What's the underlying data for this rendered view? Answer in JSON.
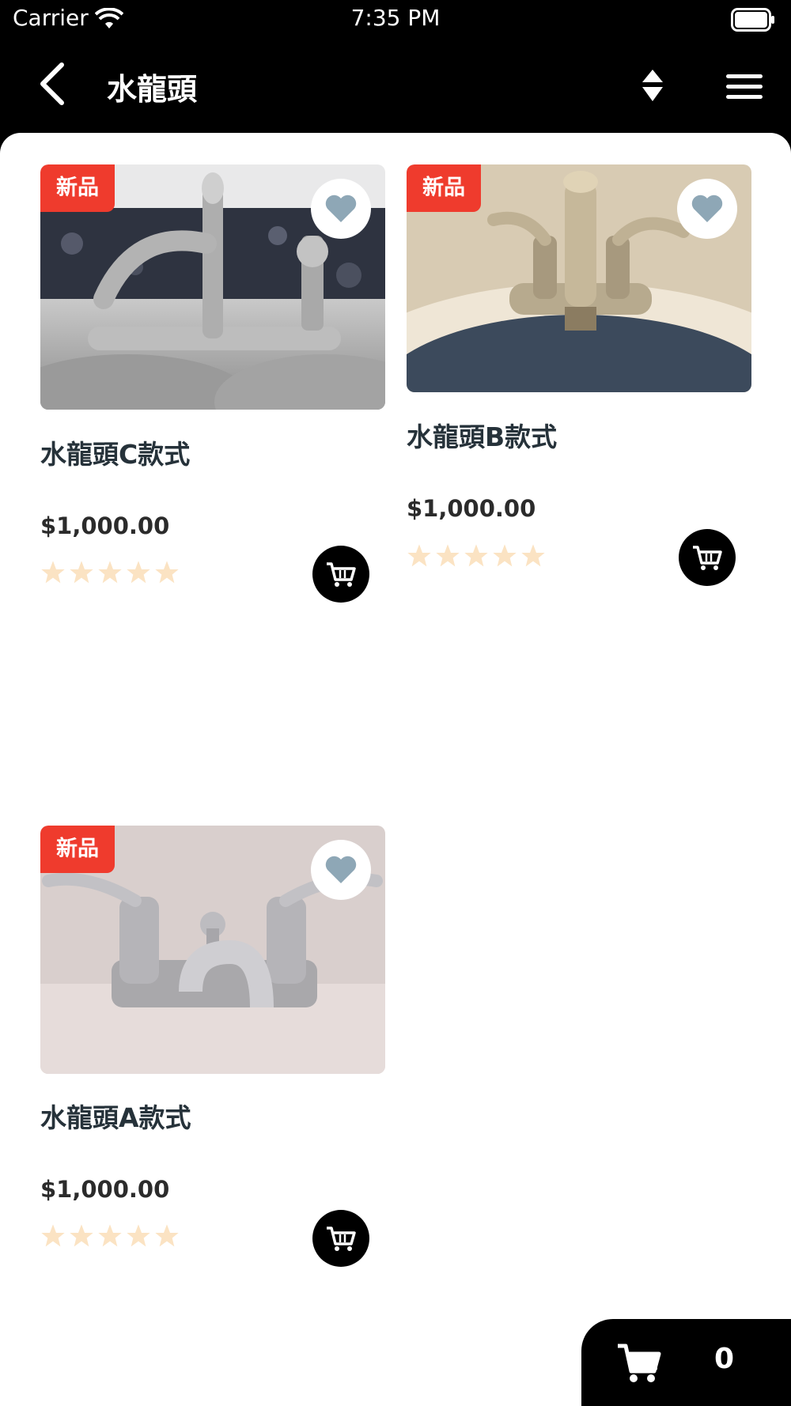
{
  "status_bar": {
    "carrier": "Carrier",
    "time": "7:35 PM"
  },
  "nav": {
    "title": "水龍頭"
  },
  "products": [
    {
      "badge": "新品",
      "title": "水龍頭C款式",
      "price": "$1,000.00",
      "rating": 0
    },
    {
      "badge": "新品",
      "title": "水龍頭B款式",
      "price": "$1,000.00",
      "rating": 0
    },
    {
      "badge": "新品",
      "title": "水龍頭A款式",
      "price": "$1,000.00",
      "rating": 0
    }
  ],
  "cart": {
    "count": "0"
  },
  "colors": {
    "badge": "#ef3b2d",
    "star_empty": "#fbe3c3",
    "heart": "#8ea7b6"
  }
}
